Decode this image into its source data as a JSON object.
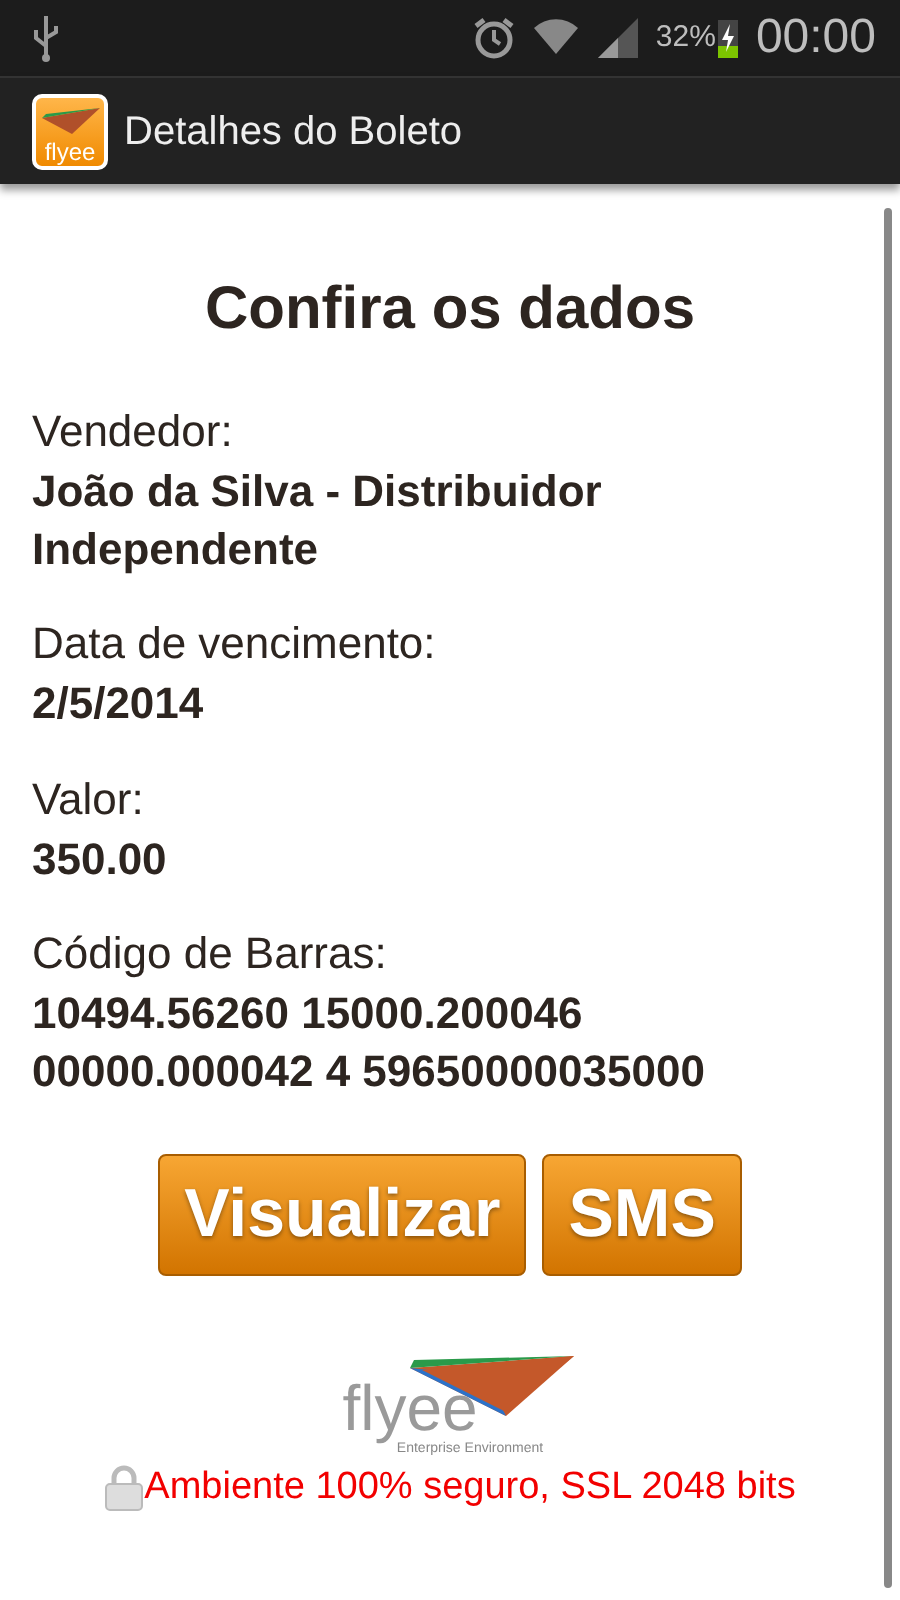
{
  "status_bar": {
    "battery_percent": "32%",
    "time": "00:00"
  },
  "action_bar": {
    "app_logo_text": "flyee",
    "title": "Detalhes do Boleto"
  },
  "heading": "Confira os dados",
  "fields": [
    {
      "label": "Vendedor:",
      "value": "João da Silva - Distribuidor Independente"
    },
    {
      "label": "Data de vencimento:",
      "value": "2/5/2014"
    },
    {
      "label": "Valor:",
      "value": "350.00"
    },
    {
      "label": "Código de Barras:",
      "value": "10494.56260 15000.200046 00000.000042 4 59650000035000"
    }
  ],
  "buttons": [
    "Visualizar",
    "SMS"
  ],
  "footer": {
    "logo_text": "flyee",
    "logo_tagline": "Enterprise Environment",
    "security_note": "Ambiente 100% seguro, SSL 2048 bits"
  }
}
